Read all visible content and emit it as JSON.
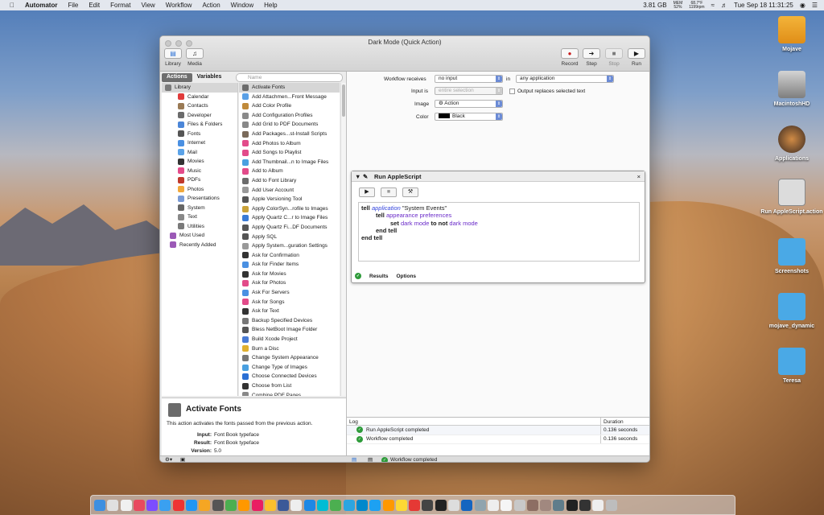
{
  "menubar": {
    "app": "Automator",
    "items": [
      "File",
      "Edit",
      "Format",
      "View",
      "Workflow",
      "Action",
      "Window",
      "Help"
    ],
    "memory": "3.81 GB",
    "mem_label": "MEM",
    "mem_pct": "52%",
    "temp": "68.7°F",
    "rpm": "1199rpm",
    "clock": "Tue Sep 18  11:31:25"
  },
  "desktop": [
    "Mojave",
    "MacintoshHD",
    "Applications",
    "Run AppleScript.action",
    "Screenshots",
    "mojave_dynamic",
    "Teresa"
  ],
  "window": {
    "title": "Dark Mode (Quick Action)",
    "tb_left": [
      "Library",
      "Media"
    ],
    "tb_right": [
      "Record",
      "Step",
      "Stop",
      "Run"
    ]
  },
  "tabs": {
    "actions": "Actions",
    "variables": "Variables",
    "search_placeholder": "Name"
  },
  "library": [
    "Library",
    "Calendar",
    "Contacts",
    "Developer",
    "Files & Folders",
    "Fonts",
    "Internet",
    "Mail",
    "Movies",
    "Music",
    "PDFs",
    "Photos",
    "Presentations",
    "System",
    "Text",
    "Utilities",
    "Most Used",
    "Recently Added"
  ],
  "actions": [
    "Activate Fonts",
    "Add Attachmen...Front Message",
    "Add Color Profile",
    "Add Configuration Profiles",
    "Add Grid to PDF Documents",
    "Add Packages...st-Install Scripts",
    "Add Photos to Album",
    "Add Songs to Playlist",
    "Add Thumbnail...n to Image Files",
    "Add to Album",
    "Add to Font Library",
    "Add User Account",
    "Apple Versioning Tool",
    "Apply ColorSyn...rofile to Images",
    "Apply Quartz C...r to Image Files",
    "Apply Quartz Fi...DF Documents",
    "Apply SQL",
    "Apply System...guration Settings",
    "Ask for Confirmation",
    "Ask for Finder Items",
    "Ask for Movies",
    "Ask for Photos",
    "Ask For Servers",
    "Ask for Songs",
    "Ask for Text",
    "Backup Specified Devices",
    "Bless NetBoot Image Folder",
    "Build Xcode Project",
    "Burn a Disc",
    "Change System Appearance",
    "Change Type of Images",
    "Choose Connected Devices",
    "Choose from List",
    "Combine PDF Pages"
  ],
  "desc": {
    "title": "Activate Fonts",
    "text": "This action activates the fonts passed from the previous action.",
    "input_label": "Input:",
    "input": "Font Book typeface",
    "result_label": "Result:",
    "result": "Font Book typeface",
    "version_label": "Version:",
    "version": "5.0"
  },
  "workflow": {
    "receives_label": "Workflow receives",
    "receives": "no input",
    "in_label": "in",
    "in": "any application",
    "input_is_label": "Input is",
    "input_is": "entire selection",
    "replaces": "Output replaces selected text",
    "image_label": "Image",
    "image": "Action",
    "color_label": "Color",
    "color": "Black"
  },
  "card": {
    "title": "Run AppleScript",
    "results": "Results",
    "options": "Options",
    "code": {
      "l1a": "tell",
      "l1b": "application",
      "l1c": " \"System Events\"",
      "l2a": "tell",
      "l2b": "appearance preferences",
      "l3a": "set",
      "l3b": "dark mode",
      "l3c": "to",
      "l3d": "not",
      "l3e": "dark mode",
      "l4": "end tell",
      "l5": "end tell"
    }
  },
  "log": {
    "col_log": "Log",
    "col_dur": "Duration",
    "rows": [
      {
        "msg": "Run AppleScript completed",
        "dur": "0.136 seconds"
      },
      {
        "msg": "Workflow completed",
        "dur": "0.136 seconds"
      }
    ]
  },
  "status": "Workflow completed",
  "colors": {
    "green": "#2e9b3a",
    "purple": "#6a2bc9"
  }
}
